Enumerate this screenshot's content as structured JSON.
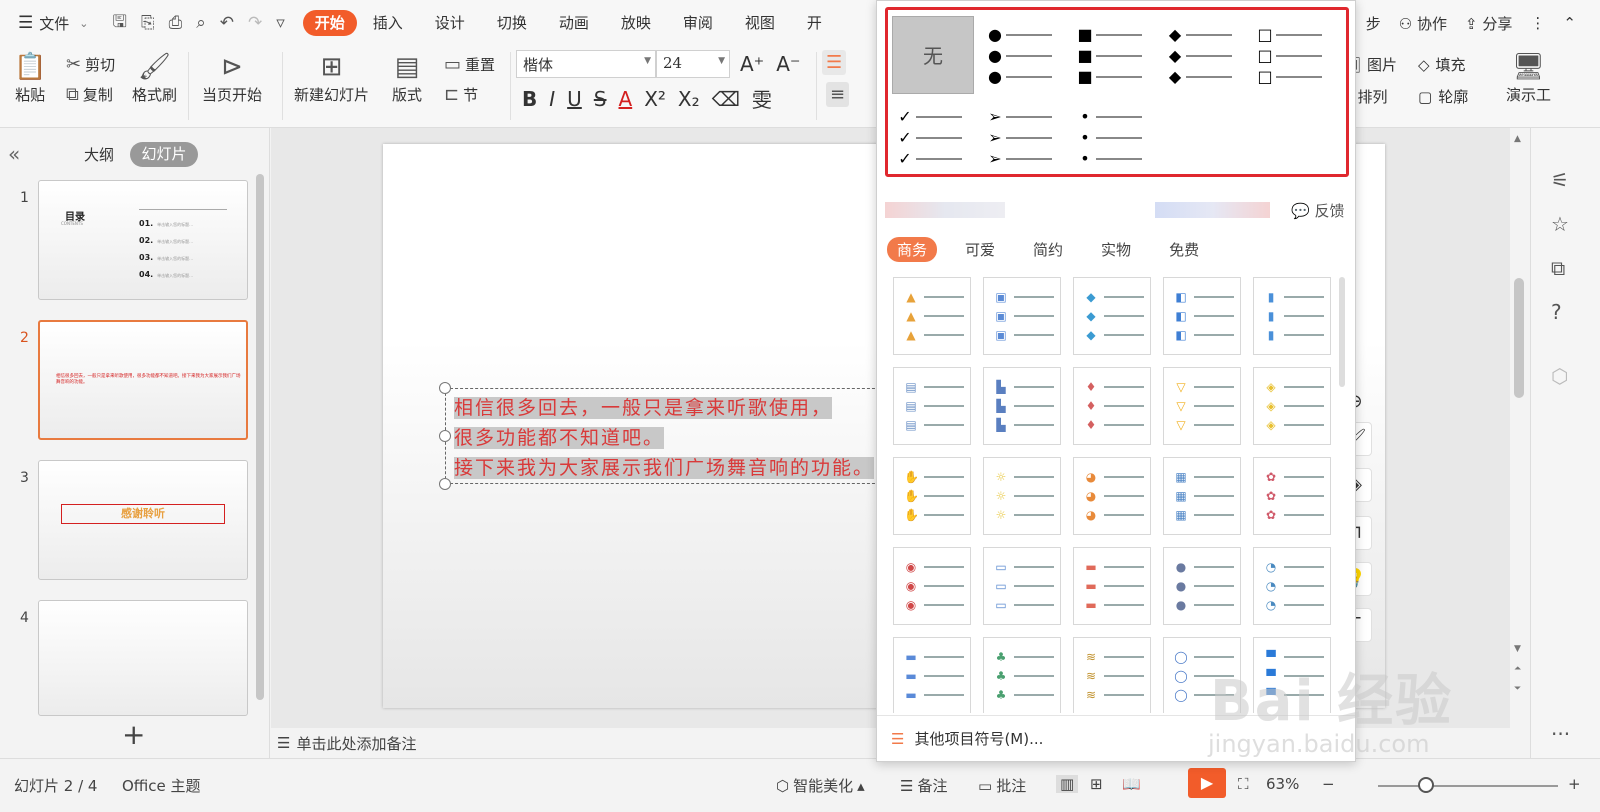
{
  "menubar": {
    "file_label": "文件",
    "tabs": [
      "开始",
      "插入",
      "设计",
      "切换",
      "动画",
      "放映",
      "审阅",
      "视图",
      "开"
    ],
    "active_tab": "开始",
    "right": {
      "sync_label": "步",
      "collab_label": "协作",
      "share_label": "分享"
    }
  },
  "ribbon": {
    "paste": "粘贴",
    "cut": "剪切",
    "copy": "复制",
    "format_painter": "格式刷",
    "from_current": "当页开始",
    "new_slide": "新建幻灯片",
    "layout": "版式",
    "reset": "重置",
    "section": "节",
    "font_name": "楷体",
    "font_size": "24",
    "picture": "图片",
    "fill": "填充",
    "arrange": "排列",
    "outline": "轮廓",
    "present_tool": "演示工"
  },
  "left_panel": {
    "outline_tab": "大纲",
    "slides_tab": "幻灯片",
    "slide_numbers": [
      "1",
      "2",
      "3",
      "4"
    ],
    "slide1": {
      "title": "目录",
      "subtitle": "CONTENTS",
      "items": [
        {
          "num": "01.",
          "text": "单击输入您的标题..."
        },
        {
          "num": "02.",
          "text": "单击输入您的标题..."
        },
        {
          "num": "03.",
          "text": "单击输入您的标题..."
        },
        {
          "num": "04.",
          "text": "单击输入您的标题..."
        }
      ]
    },
    "slide2_text": "相信很多回去，一般只是拿来听歌使用，很多功能都不知道吧。接下来我为大家展示我们广场舞音响的功能。",
    "slide3_text": "感谢聆听"
  },
  "slide": {
    "lines": [
      "相信很多回去，一般只是拿来听歌使用，",
      "很多功能都不知道吧。",
      "接下来我为大家展示我们广场舞音响的功能。"
    ]
  },
  "notes_placeholder": "单击此处添加备注",
  "bullet_panel": {
    "none_label": "无",
    "basic_symbols": [
      "●",
      "■",
      "◆",
      "□",
      "✓",
      "➢",
      "•"
    ],
    "feedback_label": "反馈",
    "categories": [
      "商务",
      "可爱",
      "简约",
      "实物",
      "免费"
    ],
    "active_category": "商务",
    "more_label": "其他项目符号(M)..."
  },
  "statusbar": {
    "slide_position": "幻灯片 2 / 4",
    "theme": "Office 主题",
    "smart_beautify": "智能美化",
    "notes": "备注",
    "comment": "批注",
    "zoom": "63%"
  },
  "watermark": {
    "brand": "Bai 经验",
    "url": "jingyan.baidu.com"
  },
  "colors": {
    "accent": "#f25c2a",
    "highlight_border": "#e0282e",
    "slide_text": "#d93a3a"
  }
}
